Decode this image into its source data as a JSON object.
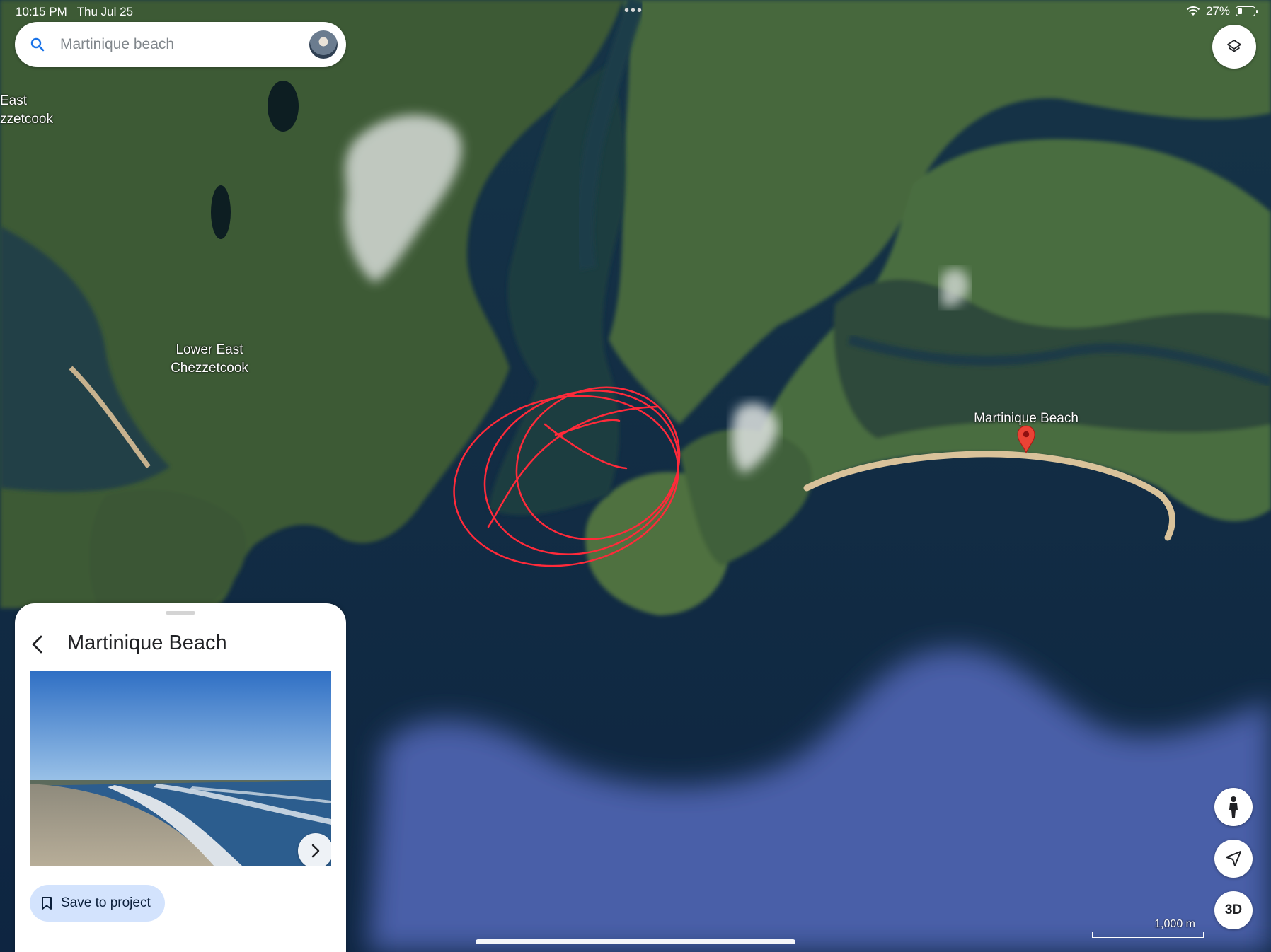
{
  "status_bar": {
    "time": "10:15 PM",
    "date": "Thu Jul 25",
    "battery": "27%",
    "battery_level": 0.27
  },
  "search": {
    "placeholder": "Martinique beach"
  },
  "map_labels": {
    "east_chezzetcook": "East\nzzetcook",
    "lower_east_chezzetcook": "Lower East\nChezzetcook",
    "martinique_beach": "Martinique Beach"
  },
  "map_controls": {
    "three_d": "3D",
    "scale": "1,000 m"
  },
  "place_card": {
    "title": "Martinique Beach",
    "save_label": "Save to project"
  },
  "colors": {
    "accent": "#1a73e8",
    "pin": "#ea4335",
    "annotation": "#ff2a3a",
    "save_bg": "#d3e3fd"
  },
  "icons": [
    "search-icon",
    "layers-icon",
    "pegman-icon",
    "navigation-arrow-icon",
    "chevron-left-icon",
    "chevron-right-icon",
    "bookmark-icon",
    "wifi-icon",
    "battery-icon",
    "map-pin-icon"
  ]
}
